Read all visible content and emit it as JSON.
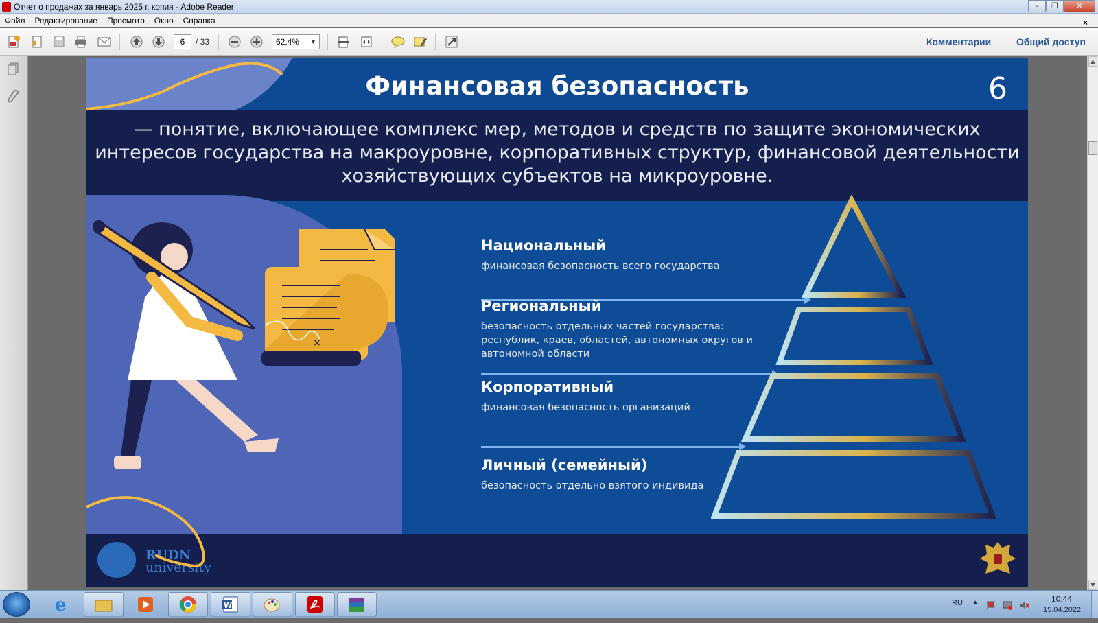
{
  "window": {
    "title": "Отчет о продажах за январь 2025 г, копия - Adobe Reader",
    "controls": {
      "minimize": "–",
      "restore": "❐",
      "close": "✕"
    }
  },
  "menu": {
    "items": [
      "Файл",
      "Редактирование",
      "Просмотр",
      "Окно",
      "Справка"
    ],
    "close_doc": "×"
  },
  "toolbar": {
    "page_current": "6",
    "page_total": "/ 33",
    "zoom": "62,4%",
    "comments_label": "Комментарии",
    "share_label": "Общий доступ"
  },
  "slide": {
    "title": "Финансовая безопасность",
    "page_number": "6",
    "definition": "— понятие, включающее комплекс мер, методов и средств по защите экономических интересов государства на макроуровне, корпоративных структур, финансовой деятельности хозяйствующих субъектов на микроуровне.",
    "levels": [
      {
        "heading": "Национальный",
        "desc": "финансовая безопасность всего государства"
      },
      {
        "heading": "Региональный",
        "desc": "безопасность отдельных частей государства: республик, краев, областей, автономных округов и автономной области"
      },
      {
        "heading": "Корпоративный",
        "desc": "финансовая безопасность организаций"
      },
      {
        "heading": "Личный (семейный)",
        "desc": "безопасность отдельно взятого индивида"
      }
    ],
    "logo_line1": "RUDN",
    "logo_line2": "university",
    "colors": {
      "primary": "#0f4c97",
      "dark": "#141f4e",
      "accent": "#f4b942",
      "arrow": "#7db3ee"
    }
  },
  "taskbar": {
    "apps": [
      "internet-explorer-icon",
      "file-explorer-icon",
      "media-player-icon",
      "chrome-icon",
      "word-icon",
      "paint-icon",
      "acrobat-icon",
      "winrar-icon"
    ],
    "lang": "RU",
    "time": "10:44",
    "date": "15.04.2022"
  }
}
